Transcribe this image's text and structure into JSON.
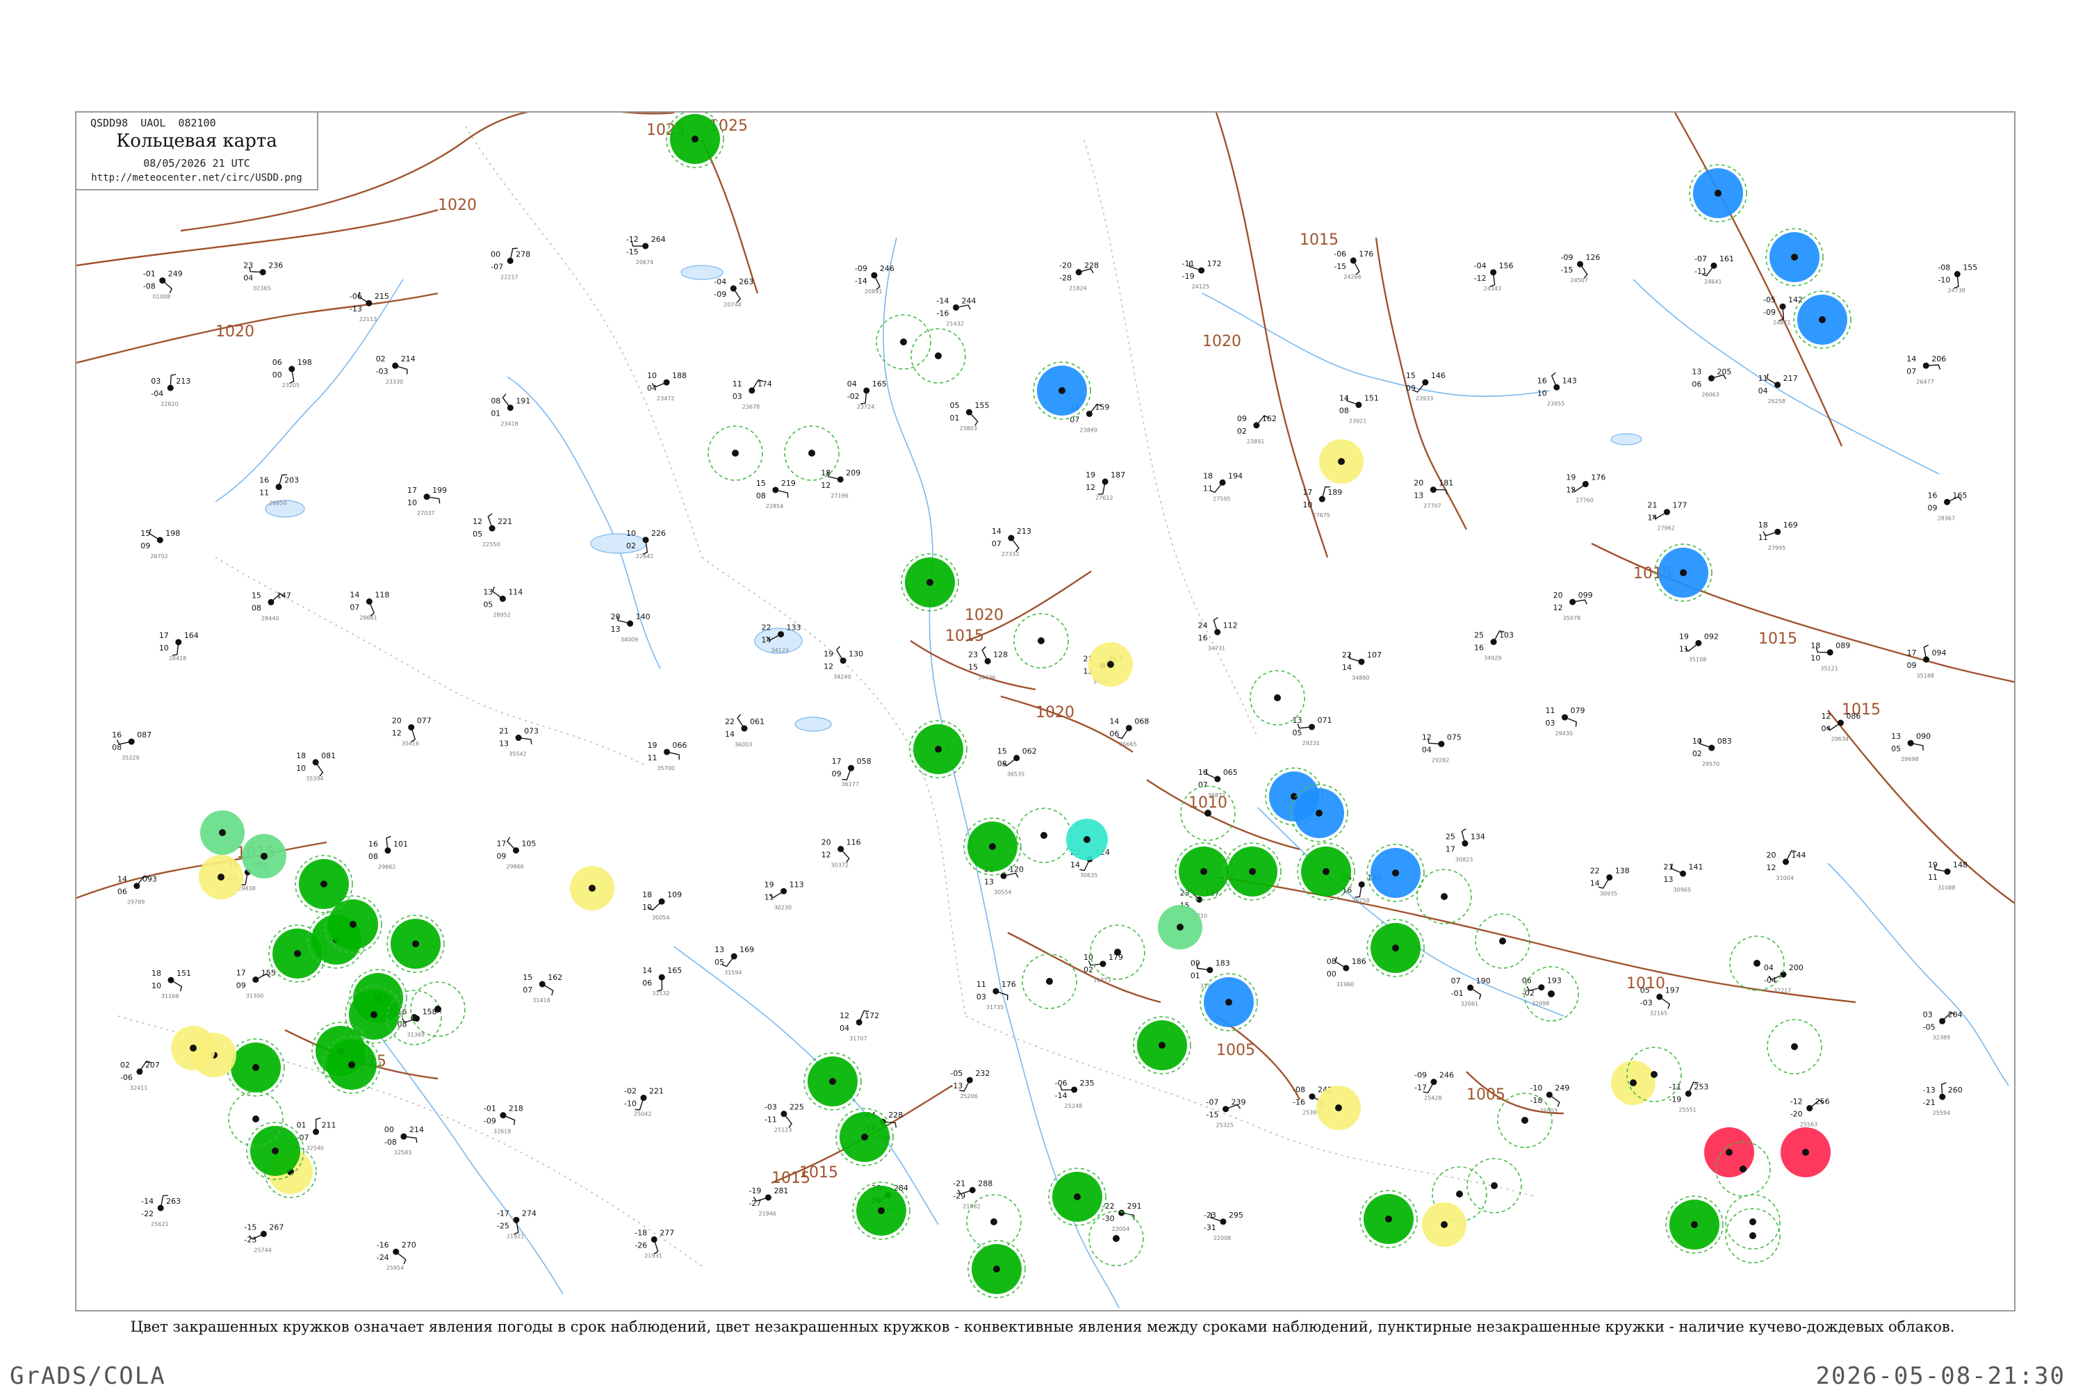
{
  "header": {
    "bulletin_code": "QSDD98  UAOL  082100",
    "title": "Кольцевая карта",
    "datetime": "08/05/2026 21 UTC",
    "url": "http://meteocenter.net/circ/USDD.png"
  },
  "legend_caption": "Цвет закрашенных кружков означает явления погоды в срок наблюдений, цвет незакрашенных кружков - конвективные явления между сроками наблюдений, пунктирные незакрашенные кружки - наличие кучево-дождевых облаков.",
  "footer": {
    "left": "GrADS/COLA",
    "right": "2026-05-08-21:30"
  },
  "colors": {
    "isobar": "#a0522d",
    "river": "#7ab8f0",
    "rain": "#00b400",
    "rain_light": "#66dd88",
    "snow": "#1e90ff",
    "fog_haze": "#f7f07a",
    "thunder": "#ff2850",
    "drizzle": "#33e6cc",
    "cb_ring": "#44bb44"
  },
  "isobars": [
    {
      "label": "1025"
    },
    {
      "label": "1020"
    },
    {
      "label": "1020"
    },
    {
      "label": "1015"
    },
    {
      "label": "1015"
    },
    {
      "label": "1020"
    },
    {
      "label": "1015"
    },
    {
      "label": "1015"
    },
    {
      "label": "1015"
    },
    {
      "label": "1010"
    },
    {
      "label": "1010"
    },
    {
      "label": "1005"
    },
    {
      "label": "1005"
    },
    {
      "label": "1020"
    },
    {
      "label": "1025"
    },
    {
      "label": "1015"
    },
    {
      "label": "1015"
    },
    {
      "label": "1015"
    },
    {
      "label": "1020"
    },
    {
      "label": "1015"
    }
  ],
  "stations": [
    {
      "temp": "-01",
      "pres": "249",
      "dew": "-08",
      "id": "01008"
    },
    {
      "temp": "23",
      "pres": "236",
      "dew": "04",
      "id": "02365"
    },
    {
      "temp": "-06",
      "pres": "215",
      "dew": "-13",
      "id": "22113"
    },
    {
      "temp": "00",
      "pres": "278",
      "dew": "-07",
      "id": "22217"
    },
    {
      "temp": "-12",
      "pres": "264",
      "dew": "-15",
      "id": "20674"
    },
    {
      "temp": "-04",
      "pres": "263",
      "dew": "-09",
      "id": "20744"
    },
    {
      "temp": "-09",
      "pres": "246",
      "dew": "-14",
      "id": "20891"
    },
    {
      "temp": "-14",
      "pres": "244",
      "dew": "-16",
      "id": "21432"
    },
    {
      "temp": "-20",
      "pres": "228",
      "dew": "-28",
      "id": "21824"
    },
    {
      "temp": "-11",
      "pres": "172",
      "dew": "-19",
      "id": "24125"
    },
    {
      "temp": "-06",
      "pres": "176",
      "dew": "-15",
      "id": "24266"
    },
    {
      "temp": "-04",
      "pres": "156",
      "dew": "-12",
      "id": "24343"
    },
    {
      "temp": "-09",
      "pres": "126",
      "dew": "-15",
      "id": "24507"
    },
    {
      "temp": "-07",
      "pres": "161",
      "dew": "-11",
      "id": "24641"
    },
    {
      "temp": "-05",
      "pres": "142",
      "dew": "-09",
      "id": "24671"
    },
    {
      "temp": "-08",
      "pres": "155",
      "dew": "-10",
      "id": "24738"
    },
    {
      "temp": "03",
      "pres": "213",
      "dew": "-04",
      "id": "22820"
    },
    {
      "temp": "06",
      "pres": "198",
      "dew": "00",
      "id": "23205"
    },
    {
      "temp": "02",
      "pres": "214",
      "dew": "-03",
      "id": "23330"
    },
    {
      "temp": "08",
      "pres": "191",
      "dew": "01",
      "id": "23418"
    },
    {
      "temp": "10",
      "pres": "188",
      "dew": "04",
      "id": "23472"
    },
    {
      "temp": "11",
      "pres": "174",
      "dew": "03",
      "id": "23678"
    },
    {
      "temp": "04",
      "pres": "165",
      "dew": "-02",
      "id": "23724"
    },
    {
      "temp": "05",
      "pres": "155",
      "dew": "01",
      "id": "23803"
    },
    {
      "temp": "12",
      "pres": "159",
      "dew": "07",
      "id": "23849"
    },
    {
      "temp": "09",
      "pres": "162",
      "dew": "02",
      "id": "23891"
    },
    {
      "temp": "14",
      "pres": "151",
      "dew": "08",
      "id": "23921"
    },
    {
      "temp": "15",
      "pres": "146",
      "dew": "09",
      "id": "23933"
    },
    {
      "temp": "16",
      "pres": "143",
      "dew": "10",
      "id": "23955"
    },
    {
      "temp": "13",
      "pres": "205",
      "dew": "06",
      "id": "26063"
    },
    {
      "temp": "11",
      "pres": "217",
      "dew": "04",
      "id": "26258"
    },
    {
      "temp": "14",
      "pres": "206",
      "dew": "07",
      "id": "26477"
    },
    {
      "temp": "15",
      "pres": "198",
      "dew": "09",
      "id": "26702"
    },
    {
      "temp": "16",
      "pres": "203",
      "dew": "11",
      "id": "26850"
    },
    {
      "temp": "17",
      "pres": "199",
      "dew": "10",
      "id": "27037"
    },
    {
      "temp": "12",
      "pres": "221",
      "dew": "05",
      "id": "22550"
    },
    {
      "temp": "10",
      "pres": "226",
      "dew": "02",
      "id": "22641"
    },
    {
      "temp": "15",
      "pres": "219",
      "dew": "08",
      "id": "22854"
    },
    {
      "temp": "18",
      "pres": "209",
      "dew": "12",
      "id": "27196"
    },
    {
      "temp": "14",
      "pres": "213",
      "dew": "07",
      "id": "27333"
    },
    {
      "temp": "19",
      "pres": "187",
      "dew": "12",
      "id": "27612"
    },
    {
      "temp": "18",
      "pres": "194",
      "dew": "11",
      "id": "27595"
    },
    {
      "temp": "17",
      "pres": "189",
      "dew": "10",
      "id": "27675"
    },
    {
      "temp": "20",
      "pres": "181",
      "dew": "13",
      "id": "27707"
    },
    {
      "temp": "19",
      "pres": "176",
      "dew": "12",
      "id": "27760"
    },
    {
      "temp": "21",
      "pres": "177",
      "dew": "14",
      "id": "27962"
    },
    {
      "temp": "18",
      "pres": "169",
      "dew": "11",
      "id": "27995"
    },
    {
      "temp": "16",
      "pres": "165",
      "dew": "09",
      "id": "28367"
    },
    {
      "temp": "17",
      "pres": "164",
      "dew": "10",
      "id": "28418"
    },
    {
      "temp": "15",
      "pres": "147",
      "dew": "08",
      "id": "28440"
    },
    {
      "temp": "14",
      "pres": "118",
      "dew": "07",
      "id": "28661"
    },
    {
      "temp": "13",
      "pres": "114",
      "dew": "05",
      "id": "28952"
    },
    {
      "temp": "20",
      "pres": "140",
      "dew": "13",
      "id": "34009"
    },
    {
      "temp": "22",
      "pres": "133",
      "dew": "14",
      "id": "34123"
    },
    {
      "temp": "19",
      "pres": "130",
      "dew": "12",
      "id": "34240"
    },
    {
      "temp": "23",
      "pres": "128",
      "dew": "15",
      "id": "34336"
    },
    {
      "temp": "21",
      "pres": "117",
      "dew": "13",
      "id": "34560"
    },
    {
      "temp": "24",
      "pres": "112",
      "dew": "16",
      "id": "34731"
    },
    {
      "temp": "22",
      "pres": "107",
      "dew": "14",
      "id": "34880"
    },
    {
      "temp": "25",
      "pres": "103",
      "dew": "16",
      "id": "34929"
    },
    {
      "temp": "20",
      "pres": "099",
      "dew": "12",
      "id": "35078"
    },
    {
      "temp": "19",
      "pres": "092",
      "dew": "11",
      "id": "35108"
    },
    {
      "temp": "18",
      "pres": "089",
      "dew": "10",
      "id": "35121"
    },
    {
      "temp": "17",
      "pres": "094",
      "dew": "09",
      "id": "35188"
    },
    {
      "temp": "16",
      "pres": "087",
      "dew": "08",
      "id": "35229"
    },
    {
      "temp": "18",
      "pres": "081",
      "dew": "10",
      "id": "35394"
    },
    {
      "temp": "20",
      "pres": "077",
      "dew": "12",
      "id": "35416"
    },
    {
      "temp": "21",
      "pres": "073",
      "dew": "13",
      "id": "35542"
    },
    {
      "temp": "19",
      "pres": "066",
      "dew": "11",
      "id": "35700"
    },
    {
      "temp": "22",
      "pres": "061",
      "dew": "14",
      "id": "36003"
    },
    {
      "temp": "17",
      "pres": "058",
      "dew": "09",
      "id": "36177"
    },
    {
      "temp": "15",
      "pres": "062",
      "dew": "08",
      "id": "36535"
    },
    {
      "temp": "14",
      "pres": "068",
      "dew": "06",
      "id": "36665"
    },
    {
      "temp": "16",
      "pres": "065",
      "dew": "07",
      "id": "36872"
    },
    {
      "temp": "13",
      "pres": "071",
      "dew": "05",
      "id": "29231"
    },
    {
      "temp": "12",
      "pres": "075",
      "dew": "04",
      "id": "29282"
    },
    {
      "temp": "11",
      "pres": "079",
      "dew": "03",
      "id": "29430"
    },
    {
      "temp": "10",
      "pres": "083",
      "dew": "02",
      "id": "29570"
    },
    {
      "temp": "12",
      "pres": "086",
      "dew": "04",
      "id": "29634"
    },
    {
      "temp": "13",
      "pres": "090",
      "dew": "05",
      "id": "29698"
    },
    {
      "temp": "14",
      "pres": "093",
      "dew": "06",
      "id": "29789"
    },
    {
      "temp": "15",
      "pres": "097",
      "dew": "07",
      "id": "29838"
    },
    {
      "temp": "16",
      "pres": "101",
      "dew": "08",
      "id": "29862"
    },
    {
      "temp": "17",
      "pres": "105",
      "dew": "09",
      "id": "29866"
    },
    {
      "temp": "18",
      "pres": "109",
      "dew": "10",
      "id": "30054"
    },
    {
      "temp": "19",
      "pres": "113",
      "dew": "11",
      "id": "30230"
    },
    {
      "temp": "20",
      "pres": "116",
      "dew": "12",
      "id": "30372"
    },
    {
      "temp": "21",
      "pres": "120",
      "dew": "13",
      "id": "30554"
    },
    {
      "temp": "22",
      "pres": "124",
      "dew": "14",
      "id": "30635"
    },
    {
      "temp": "23",
      "pres": "127",
      "dew": "15",
      "id": "30710"
    },
    {
      "temp": "24",
      "pres": "131",
      "dew": "16",
      "id": "30758"
    },
    {
      "temp": "25",
      "pres": "134",
      "dew": "17",
      "id": "30823"
    },
    {
      "temp": "22",
      "pres": "138",
      "dew": "14",
      "id": "30935"
    },
    {
      "temp": "21",
      "pres": "141",
      "dew": "13",
      "id": "30965"
    },
    {
      "temp": "20",
      "pres": "144",
      "dew": "12",
      "id": "31004"
    },
    {
      "temp": "19",
      "pres": "148",
      "dew": "11",
      "id": "31088"
    },
    {
      "temp": "18",
      "pres": "151",
      "dew": "10",
      "id": "31168"
    },
    {
      "temp": "17",
      "pres": "155",
      "dew": "09",
      "id": "31300"
    },
    {
      "temp": "16",
      "pres": "158",
      "dew": "08",
      "id": "31369"
    },
    {
      "temp": "15",
      "pres": "162",
      "dew": "07",
      "id": "31418"
    },
    {
      "temp": "14",
      "pres": "165",
      "dew": "06",
      "id": "31532"
    },
    {
      "temp": "13",
      "pres": "169",
      "dew": "05",
      "id": "31594"
    },
    {
      "temp": "12",
      "pres": "172",
      "dew": "04",
      "id": "31707"
    },
    {
      "temp": "11",
      "pres": "176",
      "dew": "03",
      "id": "31735"
    },
    {
      "temp": "10",
      "pres": "179",
      "dew": "02",
      "id": "31873"
    },
    {
      "temp": "09",
      "pres": "183",
      "dew": "01",
      "id": "31909"
    },
    {
      "temp": "08",
      "pres": "186",
      "dew": "00",
      "id": "31960"
    },
    {
      "temp": "07",
      "pres": "190",
      "dew": "-01",
      "id": "32061"
    },
    {
      "temp": "06",
      "pres": "193",
      "dew": "-02",
      "id": "32098"
    },
    {
      "temp": "05",
      "pres": "197",
      "dew": "-03",
      "id": "32165"
    },
    {
      "temp": "04",
      "pres": "200",
      "dew": "-04",
      "id": "32217"
    },
    {
      "temp": "03",
      "pres": "204",
      "dew": "-05",
      "id": "32389"
    },
    {
      "temp": "02",
      "pres": "207",
      "dew": "-06",
      "id": "32411"
    },
    {
      "temp": "01",
      "pres": "211",
      "dew": "-07",
      "id": "32540"
    },
    {
      "temp": "00",
      "pres": "214",
      "dew": "-08",
      "id": "32583"
    },
    {
      "temp": "-01",
      "pres": "218",
      "dew": "-09",
      "id": "32618"
    },
    {
      "temp": "-02",
      "pres": "221",
      "dew": "-10",
      "id": "25042"
    },
    {
      "temp": "-03",
      "pres": "225",
      "dew": "-11",
      "id": "25123"
    },
    {
      "temp": "-04",
      "pres": "228",
      "dew": "-12",
      "id": "25138"
    },
    {
      "temp": "-05",
      "pres": "232",
      "dew": "-13",
      "id": "25206"
    },
    {
      "temp": "-06",
      "pres": "235",
      "dew": "-14",
      "id": "25248"
    },
    {
      "temp": "-07",
      "pres": "239",
      "dew": "-15",
      "id": "25325"
    },
    {
      "temp": "-08",
      "pres": "242",
      "dew": "-16",
      "id": "25399"
    },
    {
      "temp": "-09",
      "pres": "246",
      "dew": "-17",
      "id": "25428"
    },
    {
      "temp": "-10",
      "pres": "249",
      "dew": "-18",
      "id": "25503"
    },
    {
      "temp": "-11",
      "pres": "253",
      "dew": "-19",
      "id": "25551"
    },
    {
      "temp": "-12",
      "pres": "256",
      "dew": "-20",
      "id": "25563"
    },
    {
      "temp": "-13",
      "pres": "260",
      "dew": "-21",
      "id": "25594"
    },
    {
      "temp": "-14",
      "pres": "263",
      "dew": "-22",
      "id": "25621"
    },
    {
      "temp": "-15",
      "pres": "267",
      "dew": "-23",
      "id": "25744"
    },
    {
      "temp": "-16",
      "pres": "270",
      "dew": "-24",
      "id": "25954"
    },
    {
      "temp": "-17",
      "pres": "274",
      "dew": "-25",
      "id": "21921"
    },
    {
      "temp": "-18",
      "pres": "277",
      "dew": "-26",
      "id": "21931"
    },
    {
      "temp": "-19",
      "pres": "281",
      "dew": "-27",
      "id": "21946"
    },
    {
      "temp": "-20",
      "pres": "284",
      "dew": "-28",
      "id": "21965"
    },
    {
      "temp": "-21",
      "pres": "288",
      "dew": "-29",
      "id": "21982"
    },
    {
      "temp": "-22",
      "pres": "291",
      "dew": "-30",
      "id": "22004"
    },
    {
      "temp": "-23",
      "pres": "295",
      "dew": "-31",
      "id": "22008"
    }
  ],
  "wx_circles": [
    {
      "type": "rain_cb"
    },
    {
      "type": "snow"
    },
    {
      "type": "snow"
    },
    {
      "type": "snow"
    },
    {
      "type": "snow"
    },
    {
      "type": "snow"
    },
    {
      "type": "cb_ring"
    },
    {
      "type": "cb_ring"
    },
    {
      "type": "cb_ring"
    },
    {
      "type": "cb_ring"
    },
    {
      "type": "fog"
    },
    {
      "type": "rain_cb"
    },
    {
      "type": "cb_ring"
    },
    {
      "type": "fog"
    },
    {
      "type": "snow"
    },
    {
      "type": "cb_ring"
    },
    {
      "type": "cb_ring"
    },
    {
      "type": "cb_ring"
    },
    {
      "type": "rain_cb"
    },
    {
      "type": "snow"
    },
    {
      "type": "rain"
    },
    {
      "type": "drizzle"
    },
    {
      "type": "rain"
    },
    {
      "type": "rain"
    },
    {
      "type": "rain"
    },
    {
      "type": "snow"
    },
    {
      "type": "rain"
    },
    {
      "type": "rain_light"
    },
    {
      "type": "snow"
    },
    {
      "type": "rain"
    },
    {
      "type": "cb_ring"
    },
    {
      "type": "cb_ring"
    },
    {
      "type": "cb_ring"
    },
    {
      "type": "cb_ring"
    },
    {
      "type": "cb_ring"
    },
    {
      "type": "cb_ring"
    },
    {
      "type": "cb_ring"
    },
    {
      "type": "fog"
    },
    {
      "type": "fog"
    },
    {
      "type": "thunder"
    },
    {
      "type": "thunder"
    },
    {
      "type": "rain"
    },
    {
      "type": "rain"
    },
    {
      "type": "rain"
    },
    {
      "type": "rain"
    },
    {
      "type": "cb_ring"
    },
    {
      "type": "cb_ring"
    },
    {
      "type": "cb_ring"
    },
    {
      "type": "cb_ring"
    },
    {
      "type": "cb_ring"
    },
    {
      "type": "cb_ring"
    },
    {
      "type": "rain"
    },
    {
      "type": "cb_ring"
    },
    {
      "type": "fog"
    },
    {
      "type": "rain_light"
    },
    {
      "type": "rain_light"
    },
    {
      "type": "fog"
    },
    {
      "type": "fog"
    },
    {
      "type": "rain"
    },
    {
      "type": "rain"
    },
    {
      "type": "rain"
    },
    {
      "type": "rain"
    },
    {
      "type": "rain"
    },
    {
      "type": "rain"
    },
    {
      "type": "rain"
    },
    {
      "type": "rain"
    },
    {
      "type": "rain"
    },
    {
      "type": "cb_ring"
    },
    {
      "type": "cb_ring"
    },
    {
      "type": "rain"
    },
    {
      "type": "fog"
    },
    {
      "type": "fog"
    },
    {
      "type": "fog_cb"
    },
    {
      "type": "rain"
    },
    {
      "type": "cb_ring"
    },
    {
      "type": "rain"
    },
    {
      "type": "cb_ring"
    },
    {
      "type": "cb_ring"
    },
    {
      "type": "cb_ring"
    },
    {
      "type": "rain_cb"
    }
  ]
}
